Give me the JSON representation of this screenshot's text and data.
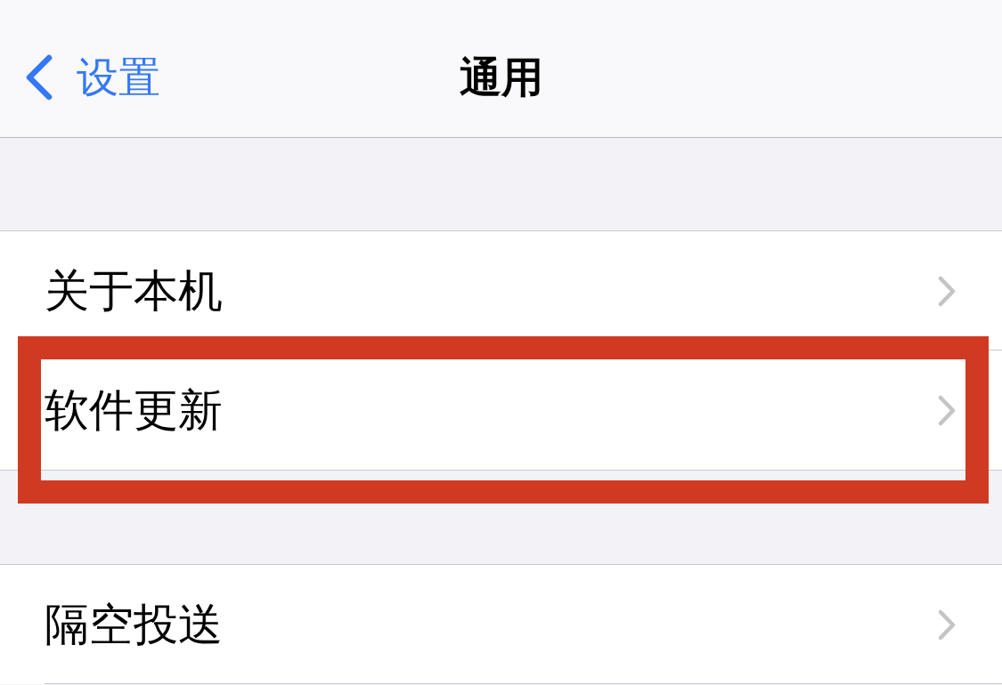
{
  "nav_bar": {
    "back_label": "设置",
    "title": "通用"
  },
  "sections": [
    {
      "items": [
        {
          "label": "关于本机",
          "highlighted": false
        },
        {
          "label": "软件更新",
          "highlighted": true
        }
      ]
    },
    {
      "items": [
        {
          "label": "隔空投送",
          "highlighted": false
        }
      ]
    }
  ]
}
